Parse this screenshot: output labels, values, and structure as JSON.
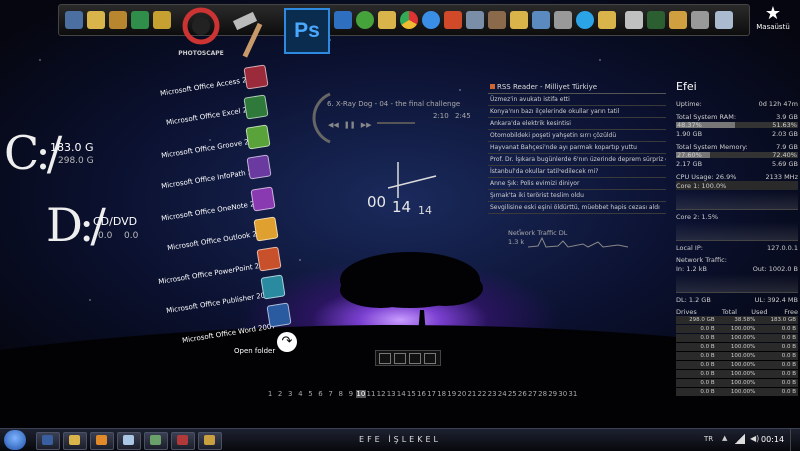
{
  "desktop": {
    "shortcut_label": "Masaüstü"
  },
  "drives": {
    "c": {
      "letter": "C:/",
      "total": "183.0 G",
      "free": "298.0 G"
    },
    "d": {
      "letter": "D:/",
      "label": "CD/DVD",
      "total": "0.0",
      "free": "0.0"
    }
  },
  "office": [
    "Microsoft Office Access 2007",
    "Microsoft Office Excel 2007",
    "Microsoft Office Groove 2007",
    "Microsoft Office InfoPath 2007",
    "Microsoft Office OneNote 2007",
    "Microsoft Office Outlook 2007",
    "Microsoft Office PowerPoint 2007",
    "Microsoft Office Publisher 2007",
    "Microsoft Office Word 2007"
  ],
  "open_folder": "Open folder",
  "apps": {
    "photoscape": "PHOTOSCAPE",
    "ps": "Ps"
  },
  "media": {
    "track": "6. X-Ray Dog - 04 - the final challenge",
    "elapsed": "2:10",
    "total": "2:45"
  },
  "rss": {
    "title": "RSS Reader - Milliyet Türkiye",
    "items": [
      "Üzmez'in avukatı istifa etti",
      "Konya'nın bazı ilçelerinde okullar yarın tatil",
      "Ankara'da elektrik kesintisi",
      "Otomobildeki poşeti yahşetin sırrı çözüldü",
      "Hayvanat Bahçesi'nde ayı parmak kopartıp yuttu",
      "Prof. Dr. İşıkara bugünlerde 6'nın üzerinde deprem sürpriz olmaz",
      "İstanbul'da okullar tatil edilecek mi?",
      "Anne Şık: Polis evimizi diniyor",
      "Şırnak'ta iki terörist teslim oldu",
      "Sevgilisine eski eşini öldürttü, müebbet hapis cezası aldı"
    ]
  },
  "clock": {
    "hour": "00",
    "min": "14",
    "sec": "14"
  },
  "network_overlay": {
    "label": "Network Traffic DL",
    "value": "1.3 k"
  },
  "sys": {
    "user": "Efei",
    "uptime_label": "Uptime:",
    "uptime": "0d 12h 47m",
    "ram_label": "Total System RAM:",
    "ram_total": "3.9 GB",
    "ram_used_pct": "48.37%",
    "ram_free_pct": "51.63%",
    "ram_used": "1.90 GB",
    "ram_free": "2.03 GB",
    "ram_fill": 0.48,
    "mem_label": "Total System Memory:",
    "mem_total": "7.9 GB",
    "mem_used_pct": "27.60%",
    "mem_free_pct": "72.40%",
    "mem_used": "2.17 GB",
    "mem_free": "5.69 GB",
    "mem_fill": 0.28,
    "cpu_label": "CPU Usage: 26.9%",
    "cpu_mhz": "2133 MHz",
    "core1": "Core 1: 100.0%",
    "core2": "Core 2: 1.5%",
    "ip_label": "Local IP:",
    "ip": "127.0.0.1",
    "net_label": "Network Traffic:",
    "net_in": "In: 1.2 kB",
    "net_out": "Out: 1002.0 B",
    "dl": "DL: 1.2 GB",
    "ul": "UL: 392.4 MB",
    "drives_head": {
      "c1": "Drives",
      "c2": "Total",
      "c3": "Used",
      "c4": "Free"
    },
    "drives_rows": [
      [
        "298.0 GB",
        "38.58%",
        "183.0 GB"
      ],
      [
        "0.0 B",
        "100.00%",
        "0.0 B"
      ],
      [
        "0.0 B",
        "100.00%",
        "0.0 B"
      ],
      [
        "0.0 B",
        "100.00%",
        "0.0 B"
      ],
      [
        "0.0 B",
        "100.00%",
        "0.0 B"
      ],
      [
        "0.0 B",
        "100.00%",
        "0.0 B"
      ],
      [
        "0.0 B",
        "100.00%",
        "0.0 B"
      ],
      [
        "0.0 B",
        "100.00%",
        "0.0 B"
      ],
      [
        "0.0 B",
        "100.00%",
        "0.0 B"
      ]
    ]
  },
  "calendar": {
    "days": [
      "1",
      "2",
      "3",
      "4",
      "5",
      "6",
      "7",
      "8",
      "9",
      "10",
      "11",
      "12",
      "13",
      "14",
      "15",
      "16",
      "17",
      "18",
      "19",
      "20",
      "21",
      "22",
      "23",
      "24",
      "25",
      "26",
      "27",
      "28",
      "29",
      "30",
      "31"
    ],
    "today": "10"
  },
  "taskbar": {
    "title": "EFE İŞLEKEL",
    "lang": "TR",
    "time": "00:14"
  }
}
